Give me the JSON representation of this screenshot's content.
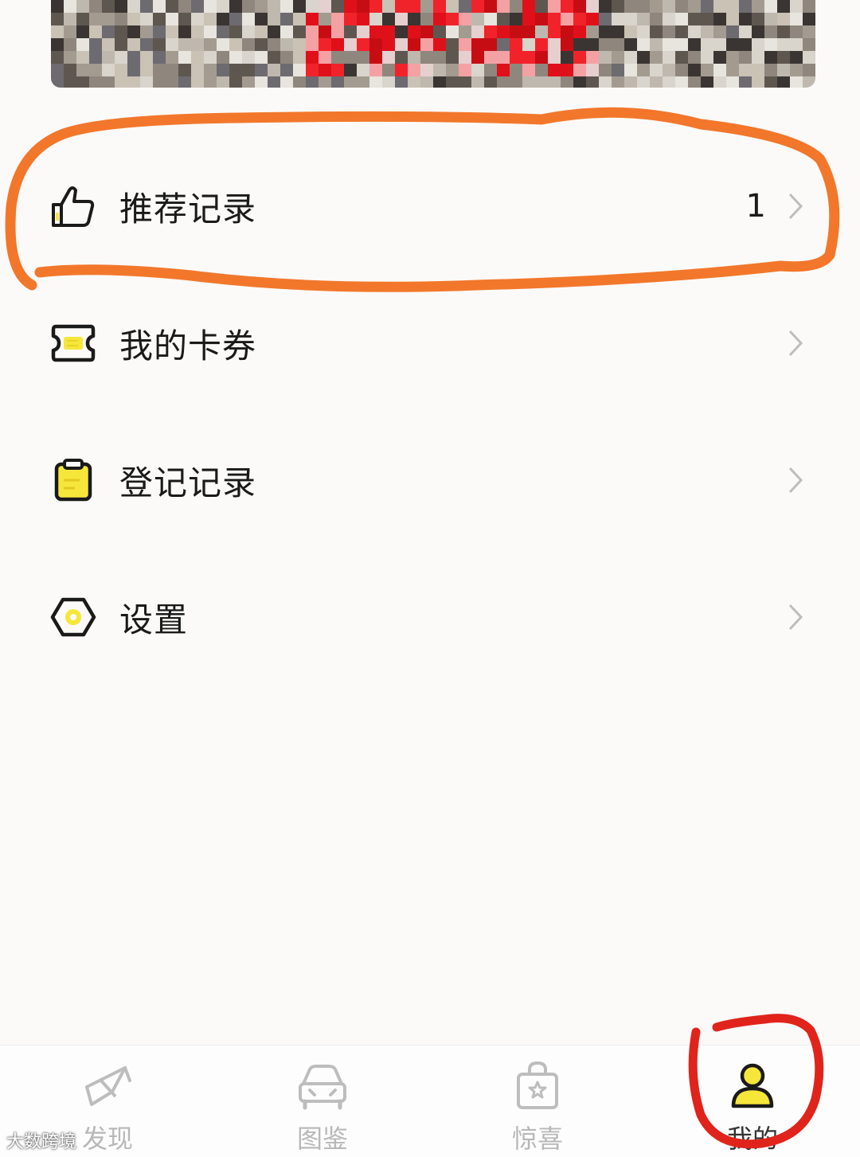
{
  "menu": {
    "items": [
      {
        "label": "推荐记录",
        "count": "1",
        "icon": "thumbs-up-icon"
      },
      {
        "label": "我的卡券",
        "count": "",
        "icon": "coupon-icon"
      },
      {
        "label": "登记记录",
        "count": "",
        "icon": "clipboard-icon"
      },
      {
        "label": "设置",
        "count": "",
        "icon": "settings-hexagon-icon"
      }
    ]
  },
  "tabbar": {
    "tabs": [
      {
        "label": "发现",
        "icon": "discover-icon",
        "active": false
      },
      {
        "label": "图鉴",
        "icon": "car-icon",
        "active": false
      },
      {
        "label": "惊喜",
        "icon": "gift-bag-icon",
        "active": false
      },
      {
        "label": "我的",
        "icon": "profile-icon",
        "active": true
      }
    ]
  },
  "watermark": "大数跨境",
  "colors": {
    "accent": "#f7e63a",
    "annotation_oval": "#f2772b",
    "annotation_circle": "#e0241b",
    "inactive_tab": "#b8b8b8"
  }
}
